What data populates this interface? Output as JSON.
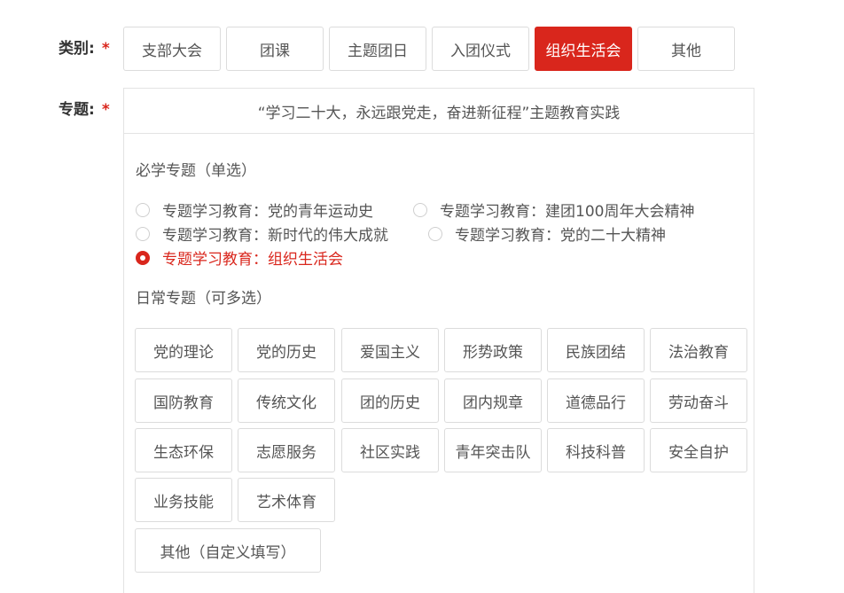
{
  "category": {
    "label": "类别:",
    "required_mark": "*",
    "options": [
      "支部大会",
      "团课",
      "主题团日",
      "入团仪式",
      "组织生活会",
      "其他"
    ],
    "selected": "组织生活会"
  },
  "topic": {
    "label": "专题:",
    "required_mark": "*",
    "title": "“学习二十大，永远跟党走，奋进新征程”主题教育实践",
    "required_section": {
      "title": "必学专题（单选）",
      "options": [
        "专题学习教育：党的青年运动史",
        "专题学习教育：建团100周年大会精神",
        "专题学习教育：新时代的伟大成就",
        "专题学习教育：党的二十大精神",
        "专题学习教育：组织生活会"
      ],
      "selected": "专题学习教育：组织生活会"
    },
    "daily_section": {
      "title": "日常专题（可多选）",
      "tags": [
        "党的理论",
        "党的历史",
        "爱国主义",
        "形势政策",
        "民族团结",
        "法治教育",
        "国防教育",
        "传统文化",
        "团的历史",
        "团内规章",
        "道德品行",
        "劳动奋斗",
        "生态环保",
        "志愿服务",
        "社区实践",
        "青年突击队",
        "科技科普",
        "安全自护",
        "业务技能",
        "艺术体育"
      ],
      "custom_tag": "其他（自定义填写）"
    }
  },
  "colors": {
    "accent": "#d9261c",
    "border": "#dcdcdc",
    "text": "#555555"
  }
}
